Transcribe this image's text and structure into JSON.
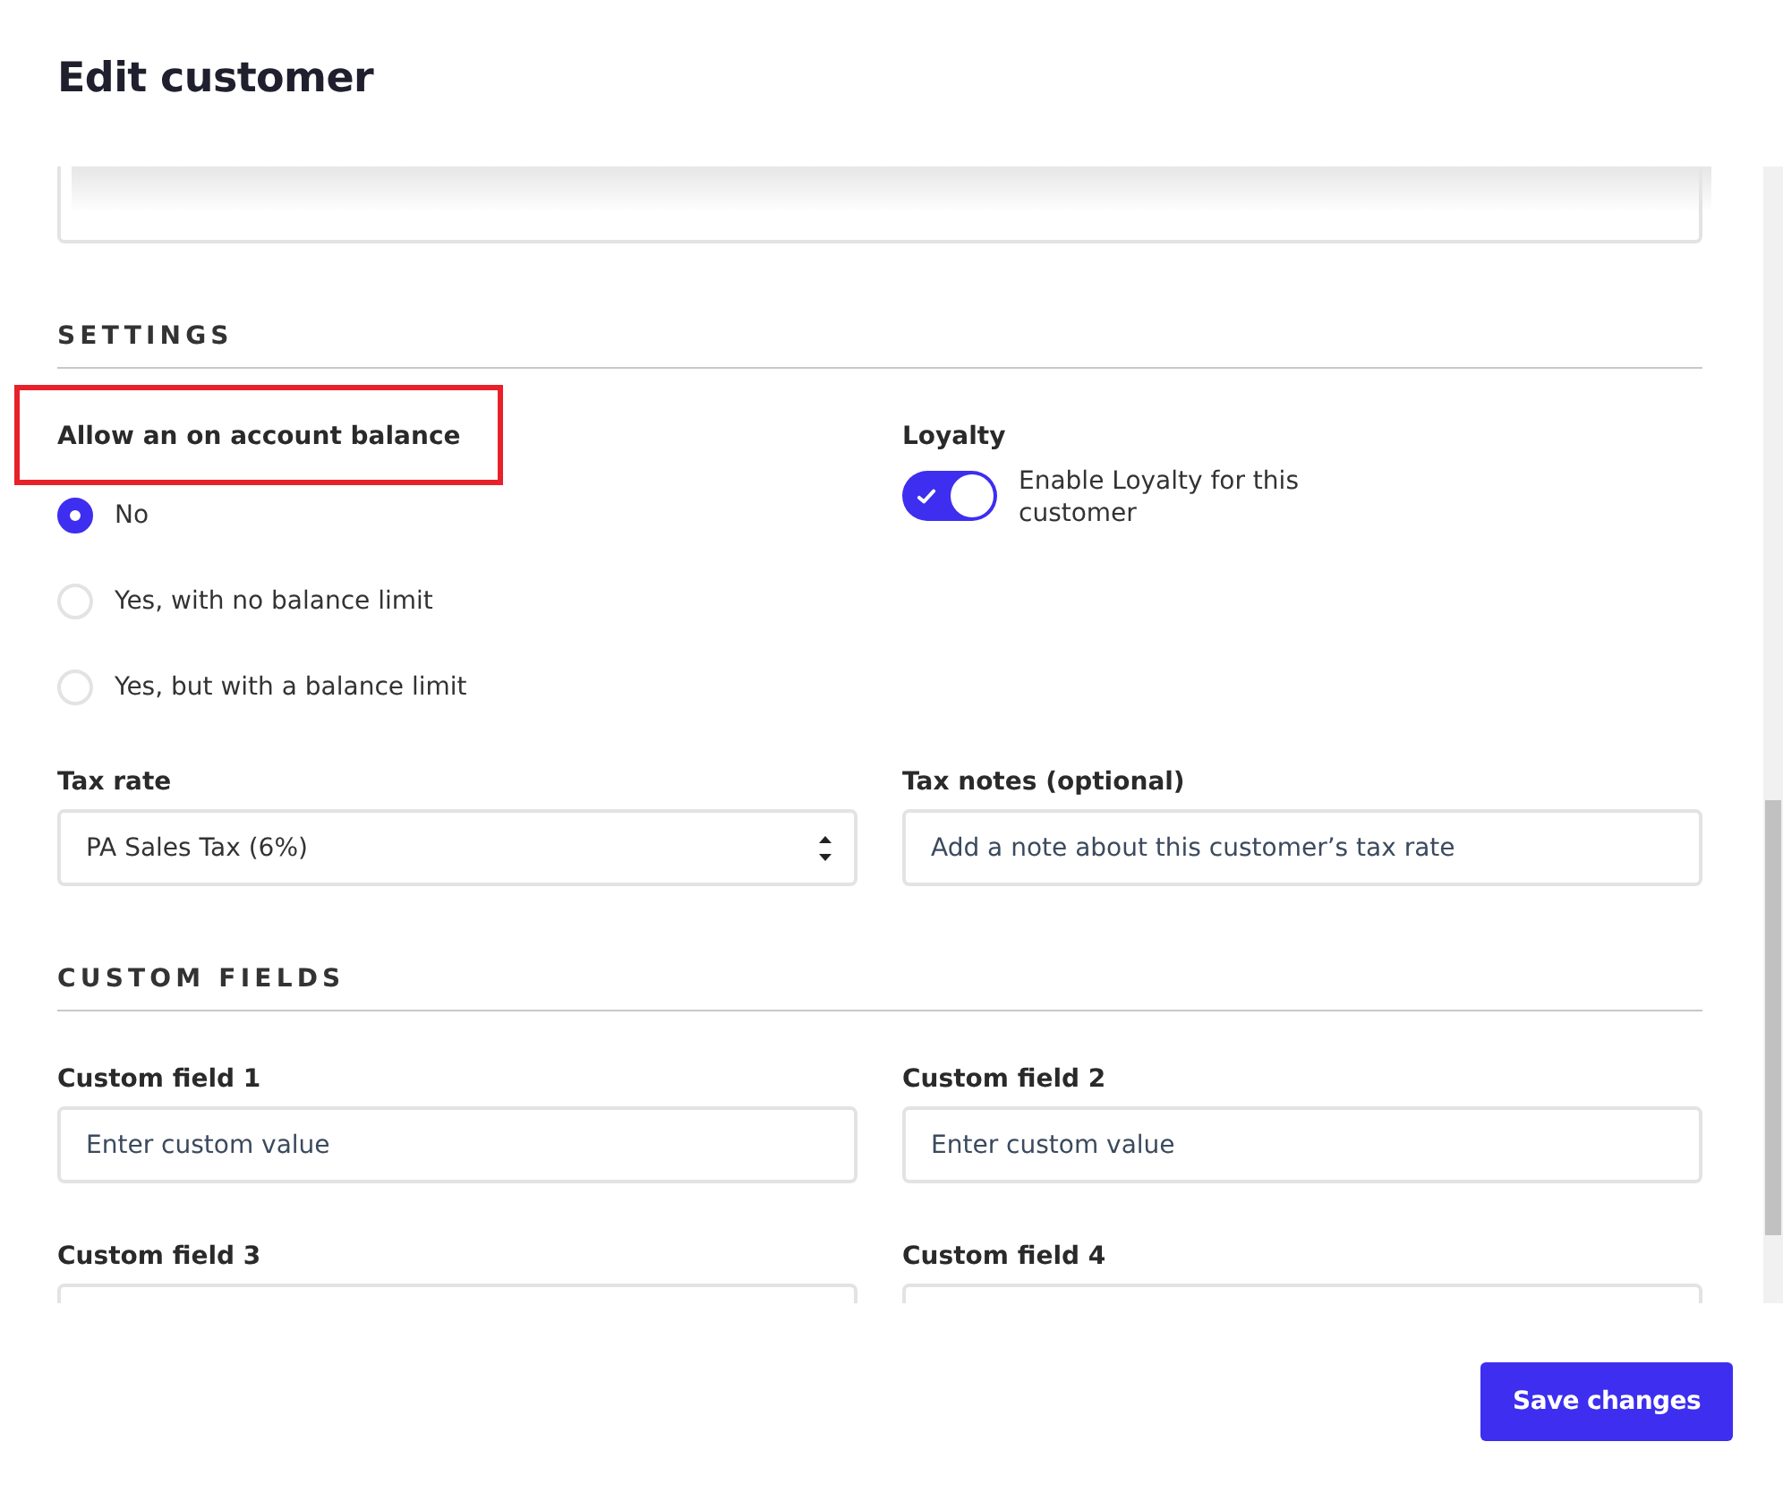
{
  "window": {
    "title": "Edit customer"
  },
  "settings": {
    "heading": "SETTINGS",
    "account_balance": {
      "label": "Allow an on account balance",
      "highlighted": true,
      "options": [
        {
          "label": "No",
          "selected": true
        },
        {
          "label": "Yes, with no balance limit",
          "selected": false
        },
        {
          "label": "Yes, but with a balance limit",
          "selected": false
        }
      ]
    },
    "loyalty": {
      "label": "Loyalty",
      "toggle_label": "Enable Loyalty for this customer",
      "on": true
    },
    "tax_rate": {
      "label": "Tax rate",
      "value": "PA Sales Tax (6%)"
    },
    "tax_notes": {
      "label": "Tax notes (optional)",
      "placeholder": "Add a note about this customer’s tax rate"
    }
  },
  "custom_fields": {
    "heading": "CUSTOM FIELDS",
    "fields": [
      {
        "label": "Custom field 1",
        "placeholder": "Enter custom value"
      },
      {
        "label": "Custom field 2",
        "placeholder": "Enter custom value"
      },
      {
        "label": "Custom field 3"
      },
      {
        "label": "Custom field 4"
      }
    ]
  },
  "buttons": [
    {
      "label": "Save changes",
      "kind": "primary"
    }
  ]
}
